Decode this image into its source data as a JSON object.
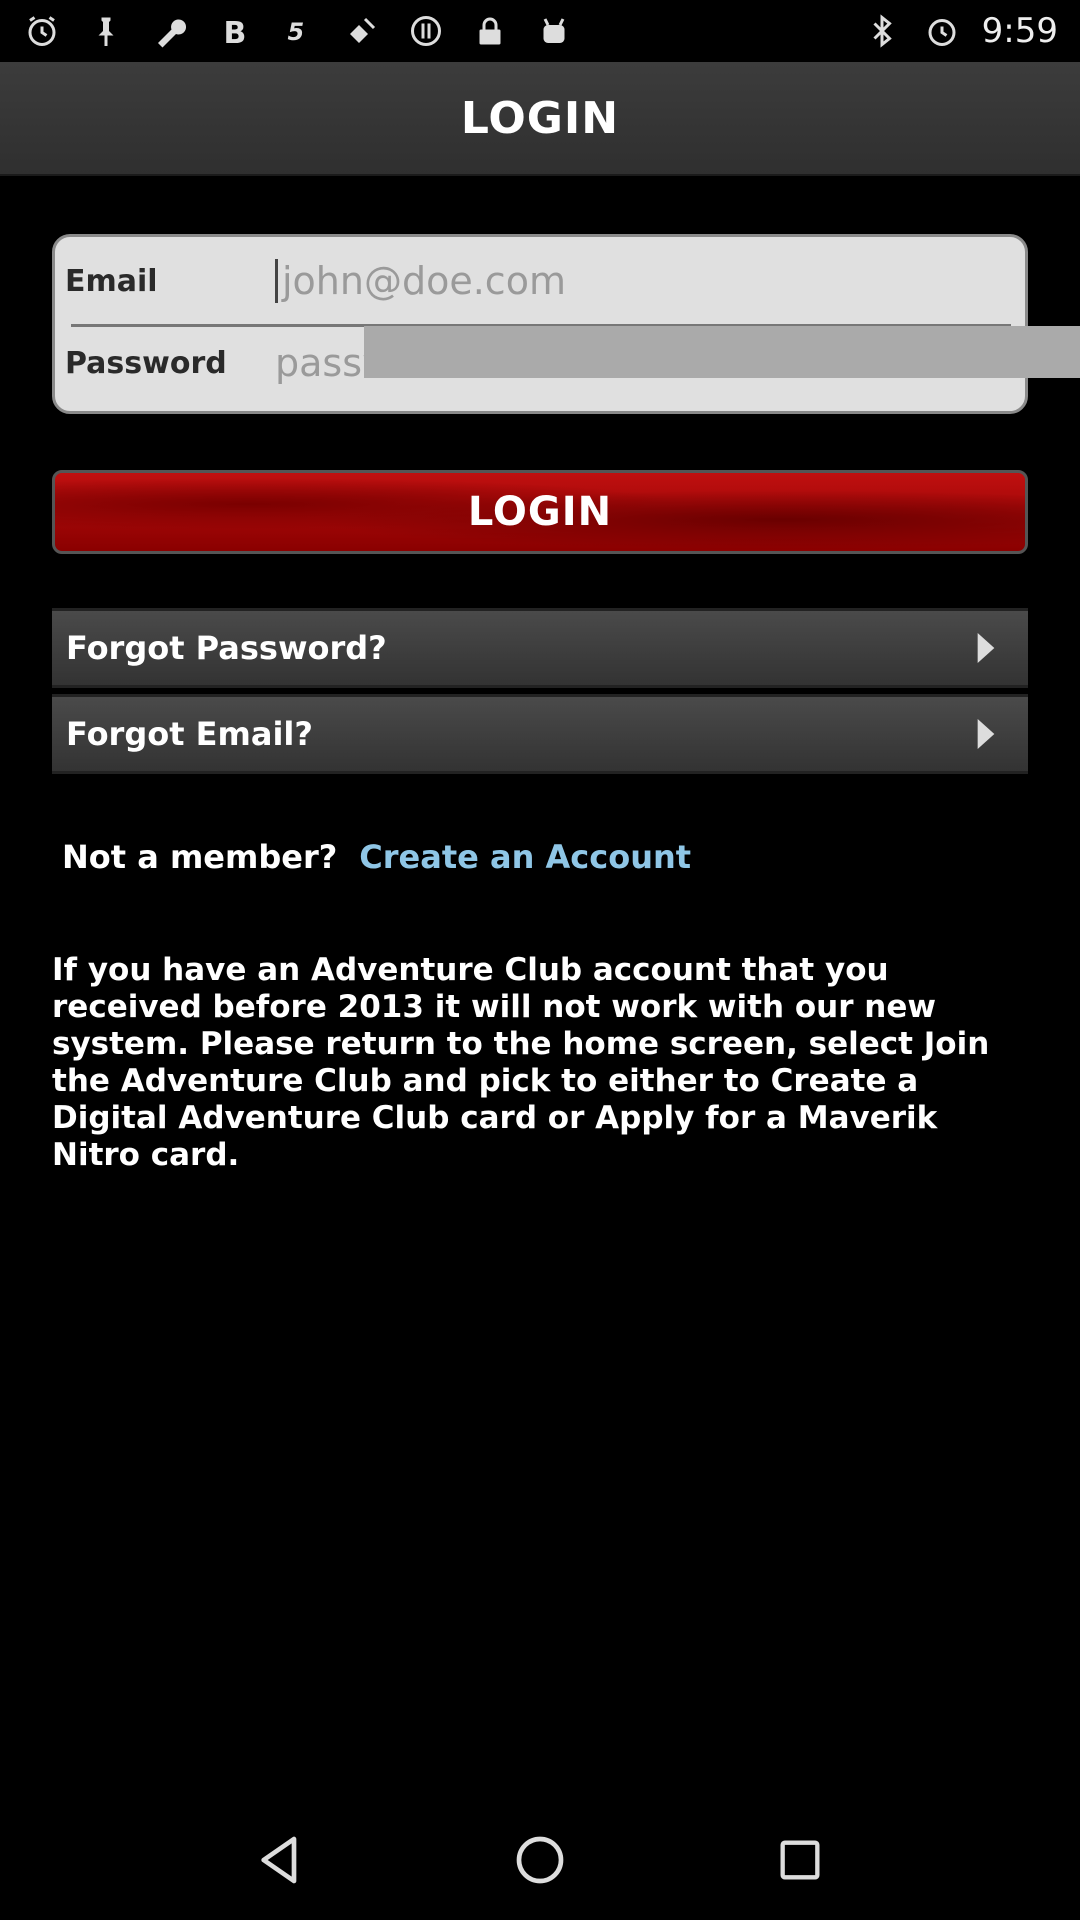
{
  "status_bar": {
    "time": "9:59",
    "left_icons": [
      "alarm-clock-icon",
      "pin-icon",
      "wrench-icon",
      "bold-b-icon",
      "s-logo-icon",
      "satellite-fake-icon",
      "alert-circle-icon",
      "lock-icon",
      "android-icon"
    ],
    "right_icons": [
      "bluetooth-icon",
      "alarm-clock-icon"
    ]
  },
  "header": {
    "title": "LOGIN"
  },
  "form": {
    "email_label": "Email",
    "email_placeholder": "john@doe.com",
    "password_label": "Password",
    "password_placeholder": "password"
  },
  "login_button": {
    "label": "LOGIN",
    "color": "#b01010"
  },
  "links": {
    "forgot_password": "Forgot Password?",
    "forgot_email": "Forgot Email?"
  },
  "member": {
    "prompt": "Not a member?",
    "create_link": "Create an Account",
    "link_color": "#8fc6e6"
  },
  "info": {
    "text": "If you have an Adventure Club account that you received before 2013 it will not work with our new system. Please return to the home screen, select Join the Adventure Club and pick to either to Create a Digital Adventure Club card or Apply for a Maverik Nitro card."
  },
  "nav": {
    "icons": [
      "back-icon",
      "home-icon",
      "recents-icon"
    ]
  }
}
